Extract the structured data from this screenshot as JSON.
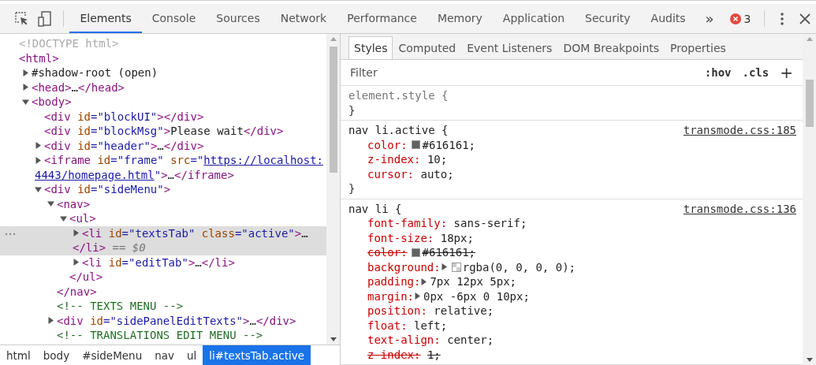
{
  "toolbar": {
    "tabs": [
      {
        "label": "Elements",
        "selected": true
      },
      {
        "label": "Console",
        "selected": false
      },
      {
        "label": "Sources",
        "selected": false
      },
      {
        "label": "Network",
        "selected": false
      },
      {
        "label": "Performance",
        "selected": false
      },
      {
        "label": "Memory",
        "selected": false
      },
      {
        "label": "Application",
        "selected": false
      },
      {
        "label": "Security",
        "selected": false
      },
      {
        "label": "Audits",
        "selected": false
      }
    ],
    "overflow": "»",
    "error_count": "3"
  },
  "dom_tree": [
    {
      "lines": [
        [
          {
            "kind": "doctype",
            "text": "<!DOCTYPE html>"
          }
        ]
      ],
      "selected": false
    },
    {
      "lines": [
        [
          {
            "kind": "tag",
            "text": "<html>"
          }
        ]
      ],
      "selected": false,
      "children": [
        {
          "expanded": false,
          "selected": false,
          "lines": [
            [
              {
                "kind": "text",
                "text": "#shadow-root (open)"
              }
            ]
          ]
        },
        {
          "expanded": false,
          "selected": false,
          "lines": [
            [
              {
                "kind": "tag",
                "text": "<head>"
              },
              {
                "kind": "text",
                "text": "…"
              },
              {
                "kind": "tag",
                "text": "</head>"
              }
            ]
          ]
        },
        {
          "expanded": true,
          "selected": false,
          "lines": [
            [
              {
                "kind": "tag",
                "text": "<body>"
              }
            ]
          ],
          "children": [
            {
              "selected": false,
              "lines": [
                [
                  {
                    "kind": "tag",
                    "text": "<div"
                  },
                  {
                    "kind": "attr",
                    "text": " id"
                  },
                  {
                    "kind": "value",
                    "text": "=\"blockUI\""
                  },
                  {
                    "kind": "tag",
                    "text": "></div>"
                  }
                ]
              ]
            },
            {
              "selected": false,
              "lines": [
                [
                  {
                    "kind": "tag",
                    "text": "<div"
                  },
                  {
                    "kind": "attr",
                    "text": " id"
                  },
                  {
                    "kind": "value",
                    "text": "=\"blockMsg\""
                  },
                  {
                    "kind": "tag",
                    "text": ">"
                  },
                  {
                    "kind": "text",
                    "text": "Please wait"
                  },
                  {
                    "kind": "tag",
                    "text": "</div>"
                  }
                ]
              ]
            },
            {
              "expanded": false,
              "selected": false,
              "lines": [
                [
                  {
                    "kind": "tag",
                    "text": "<div"
                  },
                  {
                    "kind": "attr",
                    "text": " id"
                  },
                  {
                    "kind": "value",
                    "text": "=\"header\""
                  },
                  {
                    "kind": "tag",
                    "text": ">"
                  },
                  {
                    "kind": "text",
                    "text": "…"
                  },
                  {
                    "kind": "tag",
                    "text": "</div>"
                  }
                ]
              ]
            },
            {
              "expanded": false,
              "selected": false,
              "lines": [
                [
                  {
                    "kind": "tag",
                    "text": "<iframe"
                  },
                  {
                    "kind": "attr",
                    "text": " id"
                  },
                  {
                    "kind": "value",
                    "text": "=\"frame\""
                  },
                  {
                    "kind": "attr",
                    "text": " src"
                  },
                  {
                    "kind": "value",
                    "text": "=\""
                  },
                  {
                    "kind": "link",
                    "text": "https://localhost:"
                  }
                ],
                [
                  {
                    "kind": "link",
                    "text": "4443/homepage.html"
                  },
                  {
                    "kind": "value",
                    "text": "\""
                  },
                  {
                    "kind": "tag",
                    "text": ">"
                  },
                  {
                    "kind": "text",
                    "text": "…"
                  },
                  {
                    "kind": "tag",
                    "text": "</iframe>"
                  }
                ]
              ]
            },
            {
              "expanded": true,
              "selected": false,
              "lines": [
                [
                  {
                    "kind": "tag",
                    "text": "<div"
                  },
                  {
                    "kind": "attr",
                    "text": " id"
                  },
                  {
                    "kind": "value",
                    "text": "=\"sideMenu\""
                  },
                  {
                    "kind": "tag",
                    "text": ">"
                  }
                ]
              ],
              "children": [
                {
                  "expanded": true,
                  "selected": false,
                  "lines": [
                    [
                      {
                        "kind": "tag",
                        "text": "<nav>"
                      }
                    ]
                  ],
                  "close": [
                    {
                      "kind": "tag",
                      "text": "</nav>"
                    }
                  ],
                  "children": [
                    {
                      "expanded": true,
                      "selected": false,
                      "lines": [
                        [
                          {
                            "kind": "tag",
                            "text": "<ul>"
                          }
                        ]
                      ],
                      "close": [
                        {
                          "kind": "tag",
                          "text": "</ul>"
                        }
                      ],
                      "children": [
                        {
                          "expanded": false,
                          "selected": true,
                          "lines": [
                            [
                              {
                                "kind": "tag",
                                "text": "<li"
                              },
                              {
                                "kind": "attr",
                                "text": " id"
                              },
                              {
                                "kind": "value",
                                "text": "=\"textsTab\""
                              },
                              {
                                "kind": "attr",
                                "text": " class"
                              },
                              {
                                "kind": "value",
                                "text": "=\"active\""
                              },
                              {
                                "kind": "tag",
                                "text": ">"
                              },
                              {
                                "kind": "text",
                                "text": "…"
                              }
                            ],
                            [
                              {
                                "kind": "tag",
                                "text": "</li>"
                              },
                              {
                                "kind": "marker",
                                "text": " == $0"
                              }
                            ]
                          ]
                        },
                        {
                          "expanded": false,
                          "selected": false,
                          "lines": [
                            [
                              {
                                "kind": "tag",
                                "text": "<li"
                              },
                              {
                                "kind": "attr",
                                "text": " id"
                              },
                              {
                                "kind": "value",
                                "text": "=\"editTab\""
                              },
                              {
                                "kind": "tag",
                                "text": ">"
                              },
                              {
                                "kind": "text",
                                "text": "…"
                              },
                              {
                                "kind": "tag",
                                "text": "</li>"
                              }
                            ]
                          ]
                        }
                      ]
                    }
                  ]
                },
                {
                  "selected": false,
                  "lines": [
                    [
                      {
                        "kind": "comment",
                        "text": "<!-- TEXTS MENU -->"
                      }
                    ]
                  ]
                },
                {
                  "expanded": false,
                  "selected": false,
                  "lines": [
                    [
                      {
                        "kind": "tag",
                        "text": "<div"
                      },
                      {
                        "kind": "attr",
                        "text": " id"
                      },
                      {
                        "kind": "value",
                        "text": "=\"sidePanelEditTexts\""
                      },
                      {
                        "kind": "tag",
                        "text": ">"
                      },
                      {
                        "kind": "text",
                        "text": "…"
                      },
                      {
                        "kind": "tag",
                        "text": "</div>"
                      }
                    ]
                  ]
                },
                {
                  "selected": false,
                  "lines": [
                    [
                      {
                        "kind": "comment",
                        "text": "<!-- TRANSLATIONS EDIT MENU -->"
                      }
                    ]
                  ]
                }
              ]
            }
          ]
        }
      ]
    }
  ],
  "breadcrumbs": [
    {
      "label": "html",
      "selected": false
    },
    {
      "label": "body",
      "selected": false
    },
    {
      "label": "#sideMenu",
      "selected": false
    },
    {
      "label": "nav",
      "selected": false
    },
    {
      "label": "ul",
      "selected": false
    },
    {
      "label": "li#textsTab.active",
      "selected": true
    }
  ],
  "styles_tabs": [
    {
      "label": "Styles",
      "selected": true
    },
    {
      "label": "Computed",
      "selected": false
    },
    {
      "label": "Event Listeners",
      "selected": false
    },
    {
      "label": "DOM Breakpoints",
      "selected": false
    },
    {
      "label": "Properties",
      "selected": false
    }
  ],
  "filter": {
    "placeholder": "Filter",
    "hov": ":hov",
    "cls": ".cls",
    "add": "+"
  },
  "rules": [
    {
      "kind": "inline",
      "selector": "element.style {",
      "close": "}"
    },
    {
      "kind": "rule",
      "selector": "nav li.active {",
      "source": "transmode.css:185",
      "close": "}",
      "props": [
        {
          "name": "color:",
          "value": "#616161;",
          "overridden": false,
          "swatch": {
            "kind": "solid",
            "color": "#616161"
          }
        },
        {
          "name": "z-index:",
          "value": "10;",
          "overridden": false
        },
        {
          "name": "cursor:",
          "value": "auto;",
          "overridden": false
        }
      ]
    },
    {
      "kind": "rule",
      "selector": "nav li {",
      "source": "transmode.css:136",
      "props": [
        {
          "name": "font-family:",
          "value": "sans-serif;",
          "overridden": false
        },
        {
          "name": "font-size:",
          "value": "18px;",
          "overridden": false
        },
        {
          "name": "color:",
          "value": "#616161;",
          "overridden": true,
          "swatch": {
            "kind": "solid",
            "color": "#616161"
          }
        },
        {
          "name": "background:",
          "value": "rgba(0, 0, 0, 0);",
          "overridden": false,
          "expandable": true,
          "swatch": {
            "kind": "checker"
          }
        },
        {
          "name": "padding:",
          "value": "7px 12px 5px;",
          "overridden": false,
          "expandable": true
        },
        {
          "name": "margin:",
          "value": "0px -6px 0 10px;",
          "overridden": false,
          "expandable": true
        },
        {
          "name": "position:",
          "value": "relative;",
          "overridden": false
        },
        {
          "name": "float:",
          "value": "left;",
          "overridden": false
        },
        {
          "name": "text-align:",
          "value": "center;",
          "overridden": false
        },
        {
          "name": "z-index:",
          "value": "1;",
          "overridden": true
        }
      ]
    }
  ]
}
